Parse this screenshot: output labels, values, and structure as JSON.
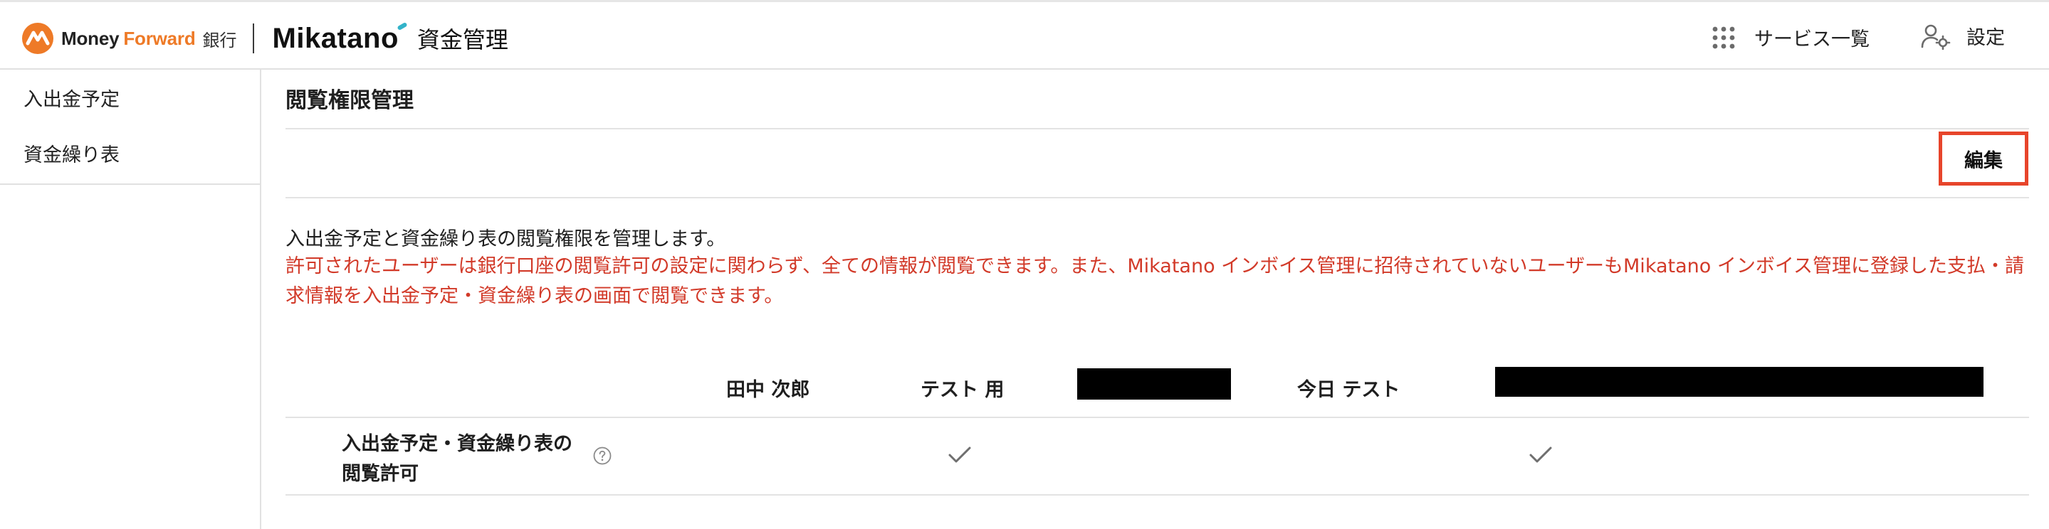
{
  "header": {
    "brand": {
      "money": "Money",
      "forward": "Forward",
      "bank": "銀行"
    },
    "product": "Mikatano",
    "app_name": "資金管理",
    "services_label": "サービス一覧",
    "settings_label": "設定"
  },
  "sidebar": {
    "items": [
      {
        "label": "入出金予定"
      },
      {
        "label": "資金繰り表"
      }
    ]
  },
  "main": {
    "title": "閲覧権限管理",
    "edit_label": "編集",
    "description": "入出金予定と資金繰り表の閲覧権限を管理します。",
    "warning": "許可されたユーザーは銀行口座の閲覧許可の設定に関わらず、全ての情報が閲覧できます。また、Mikatano インボイス管理に招待されていないユーザーもMikatano インボイス管理に登録した支払・請求情報を入出金予定・資金繰り表の画面で閲覧できます。",
    "table": {
      "columns": [
        {
          "name": "田中 次郎"
        },
        {
          "name": "テスト 用"
        },
        {
          "name": "",
          "redacted": true
        },
        {
          "name": "今日 テスト"
        },
        {
          "name": "",
          "redacted": true
        }
      ],
      "rows": [
        {
          "label": "入出金予定・資金繰り表の閲覧許可",
          "label_line1": "入出金予定・資金繰り表の",
          "label_line2": "閲覧許可",
          "permissions": [
            false,
            true,
            false,
            true,
            false
          ]
        }
      ]
    }
  },
  "colors": {
    "brand_orange": "#ee7a27",
    "warning_red": "#d23a29",
    "highlight_border": "#e7452b",
    "mikatano_accent": "#33b3c9"
  },
  "icons": {
    "services": "grid-dots-icon",
    "settings": "user-gear-icon",
    "help": "question-circle-icon",
    "check": "checkmark-icon"
  }
}
